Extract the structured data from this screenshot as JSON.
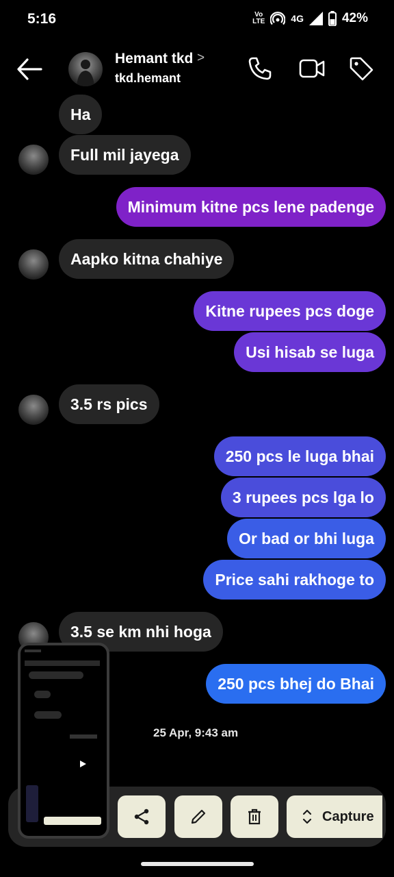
{
  "status_bar": {
    "time": "5:16",
    "volte_top": "Vo",
    "volte_bottom": "LTE",
    "network": "4G",
    "battery": "42%"
  },
  "header": {
    "name": "Hemant tkd",
    "username": "tkd.hemant",
    "chevron": ">"
  },
  "messages": [
    {
      "from": "them",
      "text": "Ha"
    },
    {
      "from": "them",
      "text": "Full mil jayega"
    },
    {
      "from": "me",
      "text": "Minimum kitne pcs lene padenge"
    },
    {
      "from": "them",
      "text": "Aapko kitna chahiye"
    },
    {
      "from": "me",
      "text": "Kitne rupees pcs doge"
    },
    {
      "from": "me",
      "text": "Usi hisab se luga"
    },
    {
      "from": "them",
      "text": "3.5 rs pics"
    },
    {
      "from": "me",
      "text": "250 pcs le luga bhai"
    },
    {
      "from": "me",
      "text": "3 rupees pcs lga lo"
    },
    {
      "from": "me",
      "text": "Or bad or bhi luga"
    },
    {
      "from": "me",
      "text": "Price sahi rakhoge to"
    },
    {
      "from": "them",
      "text": "3.5 se km nhi hoga"
    },
    {
      "from": "me",
      "text": "250 pcs bhej do Bhai"
    }
  ],
  "date_stamp": "25 Apr, 9:43 am",
  "toolbar": {
    "capture_label": "Capture"
  },
  "colors": {
    "incoming": "#262626",
    "outgoing_purple": "#7f22c8",
    "outgoing_blue": "#2a6ef0",
    "toolbar_button": "#ecebd9"
  }
}
